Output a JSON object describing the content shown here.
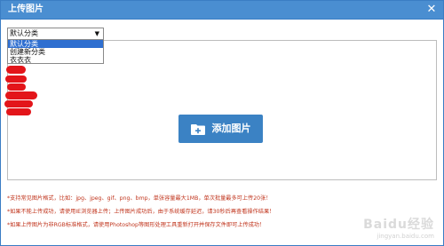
{
  "dialog": {
    "title": "上传图片",
    "close_glyph": "✕"
  },
  "category": {
    "selected": "默认分类",
    "arrow_glyph": "▼",
    "options": [
      "默认分类",
      "创建新分类",
      "衣衣衣"
    ]
  },
  "upload": {
    "button_label": "添加图片",
    "button_icon": "folder-plus-icon"
  },
  "notes": [
    "*支持常见图片格式，比如：jpg、jpeg、gif、png、bmp，单张容量最大1MB，单次批量最多可上传20张！",
    "*如果不能上传成功，请使用IE浏览器上传；上传图片成功后，由于系统缓存延迟，请30秒后再查看操作结果！",
    "*如果上传图片为非RGB标准格式，请使用Photoshop等图形处理工具重新打开并保存文件即可上传成功！"
  ],
  "watermark": {
    "brand": "Baidu经验",
    "url": "jingyan.baidu.com"
  },
  "colors": {
    "titlebar": "#4a8ed1",
    "button": "#3b82c4",
    "note_text": "#c0341c",
    "selection": "#2f6fd0",
    "redaction": "#e3151a"
  }
}
